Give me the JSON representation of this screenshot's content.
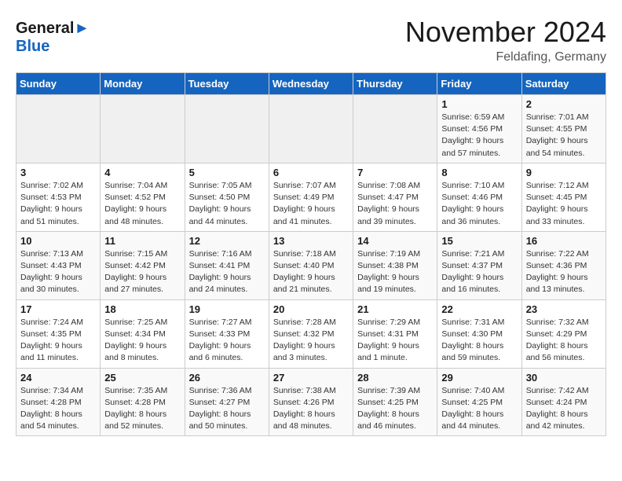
{
  "logo": {
    "line1": "General",
    "line2": "Blue"
  },
  "title": "November 2024",
  "location": "Feldafing, Germany",
  "days_of_week": [
    "Sunday",
    "Monday",
    "Tuesday",
    "Wednesday",
    "Thursday",
    "Friday",
    "Saturday"
  ],
  "weeks": [
    [
      {
        "day": "",
        "info": ""
      },
      {
        "day": "",
        "info": ""
      },
      {
        "day": "",
        "info": ""
      },
      {
        "day": "",
        "info": ""
      },
      {
        "day": "",
        "info": ""
      },
      {
        "day": "1",
        "info": "Sunrise: 6:59 AM\nSunset: 4:56 PM\nDaylight: 9 hours and 57 minutes."
      },
      {
        "day": "2",
        "info": "Sunrise: 7:01 AM\nSunset: 4:55 PM\nDaylight: 9 hours and 54 minutes."
      }
    ],
    [
      {
        "day": "3",
        "info": "Sunrise: 7:02 AM\nSunset: 4:53 PM\nDaylight: 9 hours and 51 minutes."
      },
      {
        "day": "4",
        "info": "Sunrise: 7:04 AM\nSunset: 4:52 PM\nDaylight: 9 hours and 48 minutes."
      },
      {
        "day": "5",
        "info": "Sunrise: 7:05 AM\nSunset: 4:50 PM\nDaylight: 9 hours and 44 minutes."
      },
      {
        "day": "6",
        "info": "Sunrise: 7:07 AM\nSunset: 4:49 PM\nDaylight: 9 hours and 41 minutes."
      },
      {
        "day": "7",
        "info": "Sunrise: 7:08 AM\nSunset: 4:47 PM\nDaylight: 9 hours and 39 minutes."
      },
      {
        "day": "8",
        "info": "Sunrise: 7:10 AM\nSunset: 4:46 PM\nDaylight: 9 hours and 36 minutes."
      },
      {
        "day": "9",
        "info": "Sunrise: 7:12 AM\nSunset: 4:45 PM\nDaylight: 9 hours and 33 minutes."
      }
    ],
    [
      {
        "day": "10",
        "info": "Sunrise: 7:13 AM\nSunset: 4:43 PM\nDaylight: 9 hours and 30 minutes."
      },
      {
        "day": "11",
        "info": "Sunrise: 7:15 AM\nSunset: 4:42 PM\nDaylight: 9 hours and 27 minutes."
      },
      {
        "day": "12",
        "info": "Sunrise: 7:16 AM\nSunset: 4:41 PM\nDaylight: 9 hours and 24 minutes."
      },
      {
        "day": "13",
        "info": "Sunrise: 7:18 AM\nSunset: 4:40 PM\nDaylight: 9 hours and 21 minutes."
      },
      {
        "day": "14",
        "info": "Sunrise: 7:19 AM\nSunset: 4:38 PM\nDaylight: 9 hours and 19 minutes."
      },
      {
        "day": "15",
        "info": "Sunrise: 7:21 AM\nSunset: 4:37 PM\nDaylight: 9 hours and 16 minutes."
      },
      {
        "day": "16",
        "info": "Sunrise: 7:22 AM\nSunset: 4:36 PM\nDaylight: 9 hours and 13 minutes."
      }
    ],
    [
      {
        "day": "17",
        "info": "Sunrise: 7:24 AM\nSunset: 4:35 PM\nDaylight: 9 hours and 11 minutes."
      },
      {
        "day": "18",
        "info": "Sunrise: 7:25 AM\nSunset: 4:34 PM\nDaylight: 9 hours and 8 minutes."
      },
      {
        "day": "19",
        "info": "Sunrise: 7:27 AM\nSunset: 4:33 PM\nDaylight: 9 hours and 6 minutes."
      },
      {
        "day": "20",
        "info": "Sunrise: 7:28 AM\nSunset: 4:32 PM\nDaylight: 9 hours and 3 minutes."
      },
      {
        "day": "21",
        "info": "Sunrise: 7:29 AM\nSunset: 4:31 PM\nDaylight: 9 hours and 1 minute."
      },
      {
        "day": "22",
        "info": "Sunrise: 7:31 AM\nSunset: 4:30 PM\nDaylight: 8 hours and 59 minutes."
      },
      {
        "day": "23",
        "info": "Sunrise: 7:32 AM\nSunset: 4:29 PM\nDaylight: 8 hours and 56 minutes."
      }
    ],
    [
      {
        "day": "24",
        "info": "Sunrise: 7:34 AM\nSunset: 4:28 PM\nDaylight: 8 hours and 54 minutes."
      },
      {
        "day": "25",
        "info": "Sunrise: 7:35 AM\nSunset: 4:28 PM\nDaylight: 8 hours and 52 minutes."
      },
      {
        "day": "26",
        "info": "Sunrise: 7:36 AM\nSunset: 4:27 PM\nDaylight: 8 hours and 50 minutes."
      },
      {
        "day": "27",
        "info": "Sunrise: 7:38 AM\nSunset: 4:26 PM\nDaylight: 8 hours and 48 minutes."
      },
      {
        "day": "28",
        "info": "Sunrise: 7:39 AM\nSunset: 4:25 PM\nDaylight: 8 hours and 46 minutes."
      },
      {
        "day": "29",
        "info": "Sunrise: 7:40 AM\nSunset: 4:25 PM\nDaylight: 8 hours and 44 minutes."
      },
      {
        "day": "30",
        "info": "Sunrise: 7:42 AM\nSunset: 4:24 PM\nDaylight: 8 hours and 42 minutes."
      }
    ]
  ]
}
